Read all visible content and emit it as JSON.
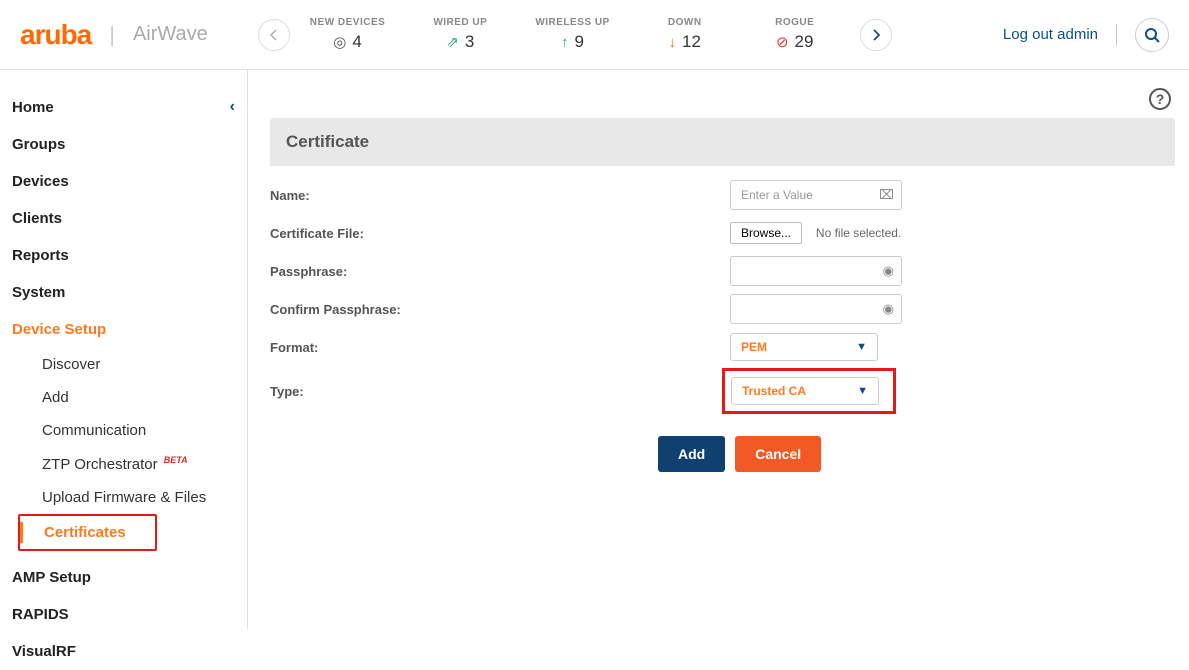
{
  "header": {
    "logo": "aruba",
    "product": "AirWave",
    "logout": "Log out admin"
  },
  "stats": {
    "new_devices": {
      "label": "NEW DEVICES",
      "value": "4"
    },
    "wired_up": {
      "label": "WIRED UP",
      "value": "3"
    },
    "wireless_up": {
      "label": "WIRELESS UP",
      "value": "9"
    },
    "down": {
      "label": "DOWN",
      "value": "12"
    },
    "rogue": {
      "label": "ROGUE",
      "value": "29"
    }
  },
  "sidebar": {
    "home": "Home",
    "groups": "Groups",
    "devices": "Devices",
    "clients": "Clients",
    "reports": "Reports",
    "system": "System",
    "device_setup": "Device Setup",
    "subs": {
      "discover": "Discover",
      "add": "Add",
      "communication": "Communication",
      "ztp": "ZTP Orchestrator",
      "beta": "BETA",
      "upload": "Upload Firmware & Files",
      "certificates": "Certificates"
    },
    "amp_setup": "AMP Setup",
    "rapids": "RAPIDS",
    "visualrf": "VisualRF"
  },
  "panel": {
    "title": "Certificate",
    "name_label": "Name:",
    "name_placeholder": "Enter a Value",
    "cert_file_label": "Certificate File:",
    "browse": "Browse...",
    "no_file": "No file selected.",
    "passphrase_label": "Passphrase:",
    "confirm_label": "Confirm Passphrase:",
    "format_label": "Format:",
    "format_value": "PEM",
    "type_label": "Type:",
    "type_value": "Trusted CA",
    "add_btn": "Add",
    "cancel_btn": "Cancel"
  }
}
